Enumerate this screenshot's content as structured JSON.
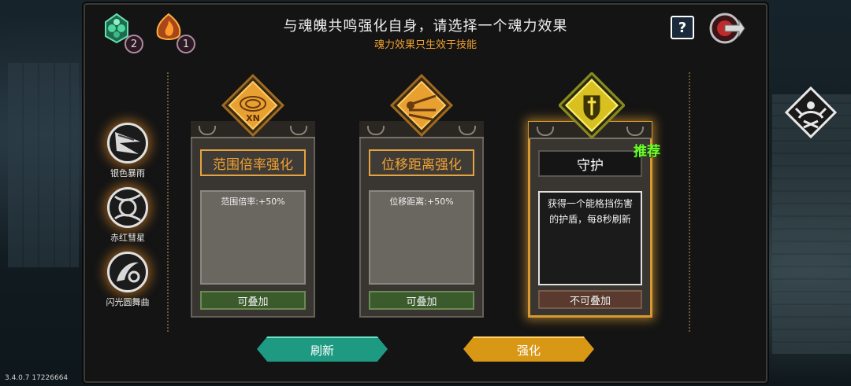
{
  "header": {
    "title": "与魂魄共鸣强化自身，请选择一个魂力效果",
    "subtitle": "魂力效果只生效于技能"
  },
  "resources": [
    {
      "icon": "green-soul-icon",
      "count": "2",
      "color": "#3fbf8a"
    },
    {
      "icon": "orange-soul-icon",
      "count": "1",
      "color": "#e07a20"
    }
  ],
  "top_buttons": {
    "help_label": "?",
    "exit_icon": "exit-arrow-icon"
  },
  "skills": [
    {
      "label": "银色暴雨",
      "icon": "silver-storm-icon"
    },
    {
      "label": "赤红彗星",
      "icon": "crimson-comet-icon"
    },
    {
      "label": "闪光圆舞曲",
      "icon": "flash-waltz-icon"
    }
  ],
  "cards": [
    {
      "name": "范围倍率强化",
      "desc": "范围倍率:+50%",
      "stack": "可叠加",
      "icon": "range-ripple-icon",
      "icon_text": "XN"
    },
    {
      "name": "位移距离强化",
      "desc": "位移距离:+50%",
      "stack": "可叠加",
      "icon": "dash-distance-icon"
    },
    {
      "name": "守护",
      "desc": "获得一个能格挡伤害的护盾，每8秒刷新",
      "stack": "不可叠加",
      "icon": "shield-sword-icon",
      "badge": "推荐"
    }
  ],
  "buttons": {
    "refresh": "刷新",
    "enhance": "强化"
  },
  "version": "3.4.0.7 17226664",
  "colors": {
    "accent_orange": "#e6a341",
    "recommend_green": "#6cff2a",
    "refresh_teal": "#1f9a82",
    "enhance_gold": "#d99716"
  }
}
